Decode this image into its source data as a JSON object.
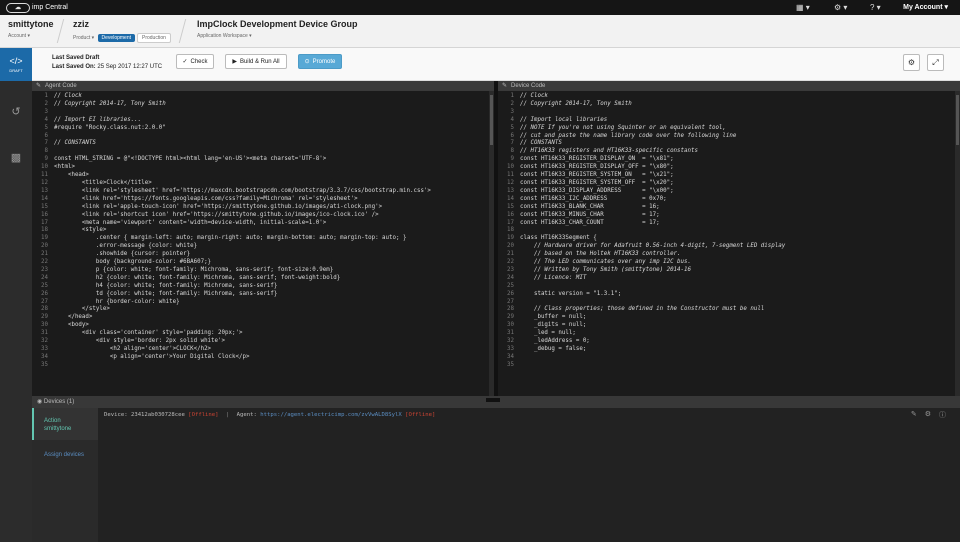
{
  "topbar": {
    "logo_text": "imp Central",
    "account_menu": "My Account"
  },
  "header": {
    "account_name": "smittytone",
    "account_label": "Account",
    "product_name": "zziz",
    "product_label": "Product",
    "env_development": "Development",
    "env_production": "Production",
    "group_name": "ImpClock Development Device Group",
    "group_label": "Application Workspace"
  },
  "nav": {
    "draft_label": "DRAFT"
  },
  "toolbar": {
    "saved_draft": "Last Saved Draft",
    "saved_on_label": "Last Saved On:",
    "saved_on_value": "25 Sep 2017 12:27 UTC",
    "check": "Check",
    "build_run": "Build & Run All",
    "promote": "Promote"
  },
  "agent_pane": {
    "title": "Agent Code",
    "lines": [
      {
        "n": "1",
        "t": "// Clock",
        "cls": "c"
      },
      {
        "n": "2",
        "t": "// Copyright 2014-17, Tony Smith",
        "cls": "c"
      },
      {
        "n": "3",
        "t": "",
        "cls": "t"
      },
      {
        "n": "4",
        "t": "// Import EI libraries...",
        "cls": "c"
      },
      {
        "n": "5",
        "t": "#require \"Rocky.class.nut:2.0.0\"",
        "cls": "k"
      },
      {
        "n": "6",
        "t": "",
        "cls": "t"
      },
      {
        "n": "7",
        "t": "// CONSTANTS",
        "cls": "c"
      },
      {
        "n": "8",
        "t": "",
        "cls": "t"
      },
      {
        "n": "9",
        "t": "const HTML_STRING = @\"<!DOCTYPE html><html lang='en-US'><meta charset='UTF-8'>",
        "cls": "w"
      },
      {
        "n": "10",
        "t": "<html>",
        "cls": "t"
      },
      {
        "n": "11",
        "t": "    <head>",
        "cls": "t"
      },
      {
        "n": "12",
        "t": "        <title>Clock</title>",
        "cls": "t"
      },
      {
        "n": "13",
        "t": "        <link rel='stylesheet' href='https://maxcdn.bootstrapcdn.com/bootstrap/3.3.7/css/bootstrap.min.css'>",
        "cls": "t"
      },
      {
        "n": "14",
        "t": "        <link href='https://fonts.googleapis.com/css?family=Michroma' rel='stylesheet'>",
        "cls": "t"
      },
      {
        "n": "15",
        "t": "        <link rel='apple-touch-icon' href='https://smittytone.github.io/images/ati-clock.png'>",
        "cls": "t"
      },
      {
        "n": "16",
        "t": "        <link rel='shortcut icon' href='https://smittytone.github.io/images/ico-clock.ico' />",
        "cls": "t"
      },
      {
        "n": "17",
        "t": "        <meta name='viewport' content='width=device-width, initial-scale=1.0'>",
        "cls": "t"
      },
      {
        "n": "18",
        "t": "        <style>",
        "cls": "t"
      },
      {
        "n": "19",
        "t": "            .center { margin-left: auto; margin-right: auto; margin-bottom: auto; margin-top: auto; }",
        "cls": "t"
      },
      {
        "n": "20",
        "t": "            .error-message {color: white}",
        "cls": "t"
      },
      {
        "n": "21",
        "t": "            .showhide {cursor: pointer}",
        "cls": "t"
      },
      {
        "n": "22",
        "t": "            body {background-color: #6BA607;}",
        "cls": "t"
      },
      {
        "n": "23",
        "t": "            p {color: white; font-family: Michroma, sans-serif; font-size:0.9em}",
        "cls": "t"
      },
      {
        "n": "24",
        "t": "            h2 {color: white; font-family: Michroma, sans-serif; font-weight:bold}",
        "cls": "t"
      },
      {
        "n": "25",
        "t": "            h4 {color: white; font-family: Michroma, sans-serif}",
        "cls": "t"
      },
      {
        "n": "26",
        "t": "            td {color: white; font-family: Michroma, sans-serif}",
        "cls": "t"
      },
      {
        "n": "27",
        "t": "            hr {border-color: white}",
        "cls": "t"
      },
      {
        "n": "28",
        "t": "        </style>",
        "cls": "t"
      },
      {
        "n": "29",
        "t": "    </head>",
        "cls": "t"
      },
      {
        "n": "30",
        "t": "    <body>",
        "cls": "t"
      },
      {
        "n": "31",
        "t": "        <div class='container' style='padding: 20px;'>",
        "cls": "t"
      },
      {
        "n": "32",
        "t": "            <div style='border: 2px solid white'>",
        "cls": "t"
      },
      {
        "n": "33",
        "t": "                <h2 align='center'>CLOCK</h2>",
        "cls": "t"
      },
      {
        "n": "34",
        "t": "                <p align='center'>Your Digital Clock</p>",
        "cls": "t"
      },
      {
        "n": "35",
        "t": "",
        "cls": "t"
      }
    ]
  },
  "device_pane": {
    "title": "Device Code",
    "lines": [
      {
        "n": "1",
        "t": "// Clock",
        "cls": "c"
      },
      {
        "n": "2",
        "t": "// Copyright 2014-17, Tony Smith",
        "cls": "c"
      },
      {
        "n": "3",
        "t": "",
        "cls": "t"
      },
      {
        "n": "4",
        "t": "// Import local libraries",
        "cls": "c"
      },
      {
        "n": "5",
        "t": "// NOTE If you're not using Squinter or an equivalent tool,",
        "cls": "c"
      },
      {
        "n": "6",
        "t": "// cut and paste the name library code over the following line",
        "cls": "c"
      },
      {
        "n": "7",
        "t": "// CONSTANTS",
        "cls": "c"
      },
      {
        "n": "8",
        "t": "// HT16K33 registers and HT16K33-specific constants",
        "cls": "c"
      },
      {
        "n": "9",
        "t": "const HT16K33_REGISTER_DISPLAY_ON  = \"\\x81\";",
        "cls": "w"
      },
      {
        "n": "10",
        "t": "const HT16K33_REGISTER_DISPLAY_OFF = \"\\x80\";",
        "cls": "w"
      },
      {
        "n": "11",
        "t": "const HT16K33_REGISTER_SYSTEM_ON   = \"\\x21\";",
        "cls": "w"
      },
      {
        "n": "12",
        "t": "const HT16K33_REGISTER_SYSTEM_OFF  = \"\\x20\";",
        "cls": "w"
      },
      {
        "n": "13",
        "t": "const HT16K33_DISPLAY_ADDRESS      = \"\\x00\";",
        "cls": "w"
      },
      {
        "n": "14",
        "t": "const HT16K33_I2C_ADDRESS          = 0x70;",
        "cls": "w"
      },
      {
        "n": "15",
        "t": "const HT16K33_BLANK_CHAR           = 16;",
        "cls": "w"
      },
      {
        "n": "16",
        "t": "const HT16K33_MINUS_CHAR           = 17;",
        "cls": "w"
      },
      {
        "n": "17",
        "t": "const HT16K33_CHAR_COUNT           = 17;",
        "cls": "w"
      },
      {
        "n": "18",
        "t": "",
        "cls": "t"
      },
      {
        "n": "19",
        "t": "class HT16K33Segment {",
        "cls": "w"
      },
      {
        "n": "20",
        "t": "    // Hardware driver for Adafruit 0.56-inch 4-digit, 7-segment LED display",
        "cls": "c"
      },
      {
        "n": "21",
        "t": "    // based on the Holtek HT16K33 controller.",
        "cls": "c"
      },
      {
        "n": "22",
        "t": "    // The LED communicates over any imp I2C bus.",
        "cls": "c"
      },
      {
        "n": "23",
        "t": "    // Written by Tony Smith (smittytone) 2014-16",
        "cls": "c"
      },
      {
        "n": "24",
        "t": "    // Licence: MIT",
        "cls": "c"
      },
      {
        "n": "25",
        "t": "",
        "cls": "t"
      },
      {
        "n": "26",
        "t": "    static version = \"1.3.1\";",
        "cls": "w"
      },
      {
        "n": "27",
        "t": "",
        "cls": "t"
      },
      {
        "n": "28",
        "t": "    // Class properties; those defined in the Constructor must be null",
        "cls": "c"
      },
      {
        "n": "29",
        "t": "    _buffer = null;",
        "cls": "w"
      },
      {
        "n": "30",
        "t": "    _digits = null;",
        "cls": "w"
      },
      {
        "n": "31",
        "t": "    _led = null;",
        "cls": "w"
      },
      {
        "n": "32",
        "t": "    _ledAddress = 0;",
        "cls": "w"
      },
      {
        "n": "33",
        "t": "    _debug = false;",
        "cls": "w"
      },
      {
        "n": "34",
        "t": "",
        "cls": "t"
      },
      {
        "n": "35",
        "t": "",
        "cls": "t"
      }
    ]
  },
  "devices": {
    "title": "Devices (1)",
    "action_label": "Action",
    "action_user": "smittytone",
    "assign": "Assign devices",
    "device_label": "Device:",
    "device_id": "23412ab030728cee",
    "device_status": "[Offline]",
    "agent_label": "Agent:",
    "agent_url": "https://agent.electricimp.com/zvVwALD8SylX",
    "agent_status": "[Offline]"
  }
}
